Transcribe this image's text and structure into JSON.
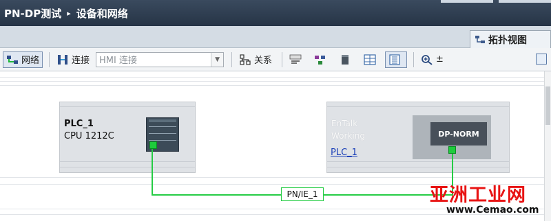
{
  "title_bar": {
    "project": "PN-DP测试",
    "separator": "▸",
    "page": "设备和网络"
  },
  "tab_bar": {
    "topology_view": "拓扑视图"
  },
  "toolbar": {
    "network": "网络",
    "connect": "连接",
    "hmi_connect": "HMI 连接",
    "relations": "关系",
    "zoom_arrow": "±"
  },
  "devices": {
    "plc": {
      "name": "PLC_1",
      "type": "CPU 1212C"
    },
    "dp": {
      "faded_line_1": "EnTalk",
      "faded_line_2": "Working",
      "link": "PLC_1",
      "module": "DP-NORM"
    }
  },
  "network": {
    "label": "PN/IE_1",
    "color": "#25cc44"
  },
  "watermark": {
    "title": "亚洲工业网",
    "url": "www.Cemao.com"
  },
  "colors": {
    "title_bg": "#263446",
    "device_bg": "#dfe2e6",
    "port": "#1ecc3c",
    "watermark": "#e81414"
  }
}
